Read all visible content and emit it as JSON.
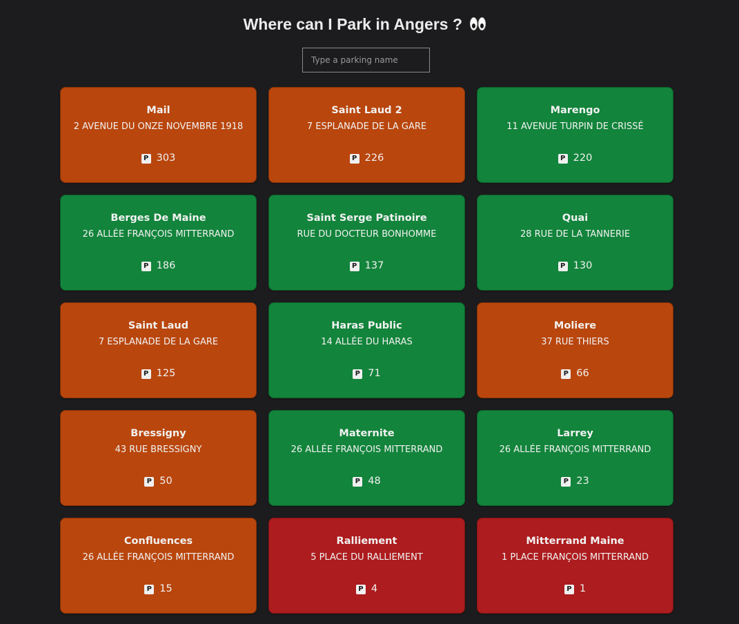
{
  "header": {
    "title": "Where can I Park in Angers ?",
    "emoji_icon": "eyes-icon"
  },
  "search": {
    "placeholder": "Type a parking name",
    "value": ""
  },
  "colors": {
    "background": "#1c1c1e",
    "high_availability": "#12843b",
    "medium_availability": "#b9460d",
    "low_availability": "#ad1c1e"
  },
  "parkings": [
    {
      "name": "Mail",
      "address": "2 AVENUE DU ONZE NOVEMBRE 1918",
      "spots": "303",
      "status": "orange"
    },
    {
      "name": "Saint Laud 2",
      "address": "7 ESPLANADE DE LA GARE",
      "spots": "226",
      "status": "orange"
    },
    {
      "name": "Marengo",
      "address": "11 AVENUE TURPIN DE CRISSÉ",
      "spots": "220",
      "status": "green"
    },
    {
      "name": "Berges De Maine",
      "address": "26 ALLÉE FRANÇOIS MITTERRAND",
      "spots": "186",
      "status": "green"
    },
    {
      "name": "Saint Serge Patinoire",
      "address": "RUE DU DOCTEUR BONHOMME",
      "spots": "137",
      "status": "green"
    },
    {
      "name": "Quai",
      "address": "28 RUE DE LA TANNERIE",
      "spots": "130",
      "status": "green"
    },
    {
      "name": "Saint Laud",
      "address": "7 ESPLANADE DE LA GARE",
      "spots": "125",
      "status": "orange"
    },
    {
      "name": "Haras Public",
      "address": "14 ALLÉE DU HARAS",
      "spots": "71",
      "status": "green"
    },
    {
      "name": "Moliere",
      "address": "37 RUE THIERS",
      "spots": "66",
      "status": "orange"
    },
    {
      "name": "Bressigny",
      "address": "43 RUE BRESSIGNY",
      "spots": "50",
      "status": "orange"
    },
    {
      "name": "Maternite",
      "address": "26 ALLÉE FRANÇOIS MITTERRAND",
      "spots": "48",
      "status": "green"
    },
    {
      "name": "Larrey",
      "address": "26 ALLÉE FRANÇOIS MITTERRAND",
      "spots": "23",
      "status": "green"
    },
    {
      "name": "Confluences",
      "address": "26 ALLÉE FRANÇOIS MITTERRAND",
      "spots": "15",
      "status": "orange"
    },
    {
      "name": "Ralliement",
      "address": "5 PLACE DU RALLIEMENT",
      "spots": "4",
      "status": "red"
    },
    {
      "name": "Mitterrand Maine",
      "address": "1 PLACE FRANÇOIS MITTERRAND",
      "spots": "1",
      "status": "red"
    }
  ],
  "parking_icon": {
    "name": "parking-icon",
    "glyph": "P"
  }
}
